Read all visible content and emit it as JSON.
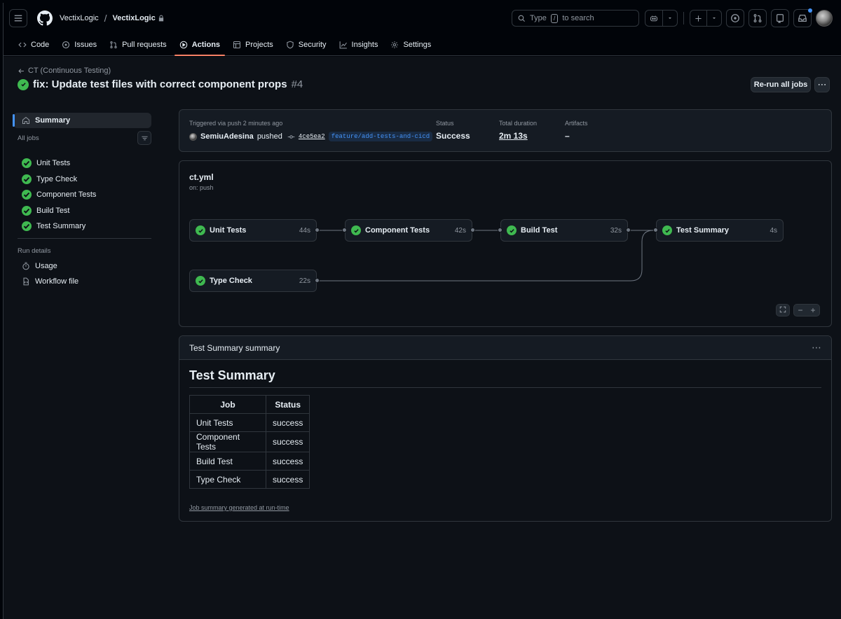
{
  "header": {
    "org": "VectixLogic",
    "repo": "VectixLogic",
    "search_placeholder_pre": "Type",
    "search_key": "/",
    "search_placeholder_post": "to search"
  },
  "tabs": [
    {
      "label": "Code",
      "icon": "code-icon"
    },
    {
      "label": "Issues",
      "icon": "issue-icon"
    },
    {
      "label": "Pull requests",
      "icon": "pull-request-icon"
    },
    {
      "label": "Actions",
      "icon": "play-icon",
      "active": true
    },
    {
      "label": "Projects",
      "icon": "table-icon"
    },
    {
      "label": "Security",
      "icon": "shield-icon"
    },
    {
      "label": "Insights",
      "icon": "graph-icon"
    },
    {
      "label": "Settings",
      "icon": "gear-icon"
    }
  ],
  "run": {
    "workflow_back": "CT (Continuous Testing)",
    "title": "fix: Update test files with correct component props",
    "number": "#4",
    "rerun_label": "Re-run all jobs"
  },
  "sidebar": {
    "summary_label": "Summary",
    "all_jobs_label": "All jobs",
    "jobs": [
      "Unit Tests",
      "Type Check",
      "Component Tests",
      "Build Test",
      "Test Summary"
    ],
    "run_details_label": "Run details",
    "usage_label": "Usage",
    "workflow_file_label": "Workflow file"
  },
  "trigger": {
    "text": "Triggered via push 2 minutes ago",
    "actor": "SemiuAdesina",
    "action": "pushed",
    "sha": "4ce5ea2",
    "branch": "feature/add-tests-and-cicd",
    "status_label": "Status",
    "status_value": "Success",
    "duration_label": "Total duration",
    "duration_value": "2m 13s",
    "artifacts_label": "Artifacts",
    "artifacts_value": "–"
  },
  "workflow": {
    "file": "ct.yml",
    "event": "on: push",
    "jobs": [
      {
        "name": "Unit Tests",
        "duration": "44s"
      },
      {
        "name": "Component Tests",
        "duration": "42s"
      },
      {
        "name": "Build Test",
        "duration": "32s"
      },
      {
        "name": "Test Summary",
        "duration": "4s"
      },
      {
        "name": "Type Check",
        "duration": "22s"
      }
    ],
    "zoom_minus": "−",
    "zoom_plus": "+"
  },
  "summary": {
    "card_title": "Test Summary summary",
    "heading": "Test Summary",
    "columns": [
      "Job",
      "Status"
    ],
    "rows": [
      [
        "Unit Tests",
        "success"
      ],
      [
        "Component Tests",
        "success"
      ],
      [
        "Build Test",
        "success"
      ],
      [
        "Type Check",
        "success"
      ]
    ],
    "footer": "Job summary generated at run-time"
  },
  "colors": {
    "success": "#3fb950",
    "accent_tab": "#f78166",
    "link": "#4493f8"
  }
}
